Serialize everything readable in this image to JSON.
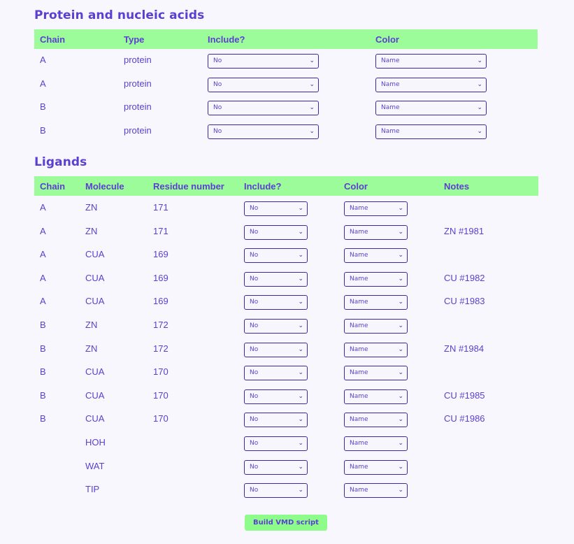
{
  "protein_section": {
    "title": "Protein and nucleic acids",
    "headers": {
      "chain": "Chain",
      "type": "Type",
      "include": "Include?",
      "color": "Color"
    },
    "rows": [
      {
        "chain": "A",
        "type": "protein",
        "include": "No",
        "color": "Name"
      },
      {
        "chain": "A",
        "type": "protein",
        "include": "No",
        "color": "Name"
      },
      {
        "chain": "B",
        "type": "protein",
        "include": "No",
        "color": "Name"
      },
      {
        "chain": "B",
        "type": "protein",
        "include": "No",
        "color": "Name"
      }
    ]
  },
  "ligand_section": {
    "title": "Ligands",
    "headers": {
      "chain": "Chain",
      "molecule": "Molecule",
      "residue": "Residue number",
      "include": "Include?",
      "color": "Color",
      "notes": "Notes"
    },
    "rows": [
      {
        "chain": "A",
        "molecule": "ZN",
        "residue": "171",
        "include": "No",
        "color": "Name",
        "notes": ""
      },
      {
        "chain": "A",
        "molecule": "ZN",
        "residue": "171",
        "include": "No",
        "color": "Name",
        "notes": "ZN #1981"
      },
      {
        "chain": "A",
        "molecule": "CUA",
        "residue": "169",
        "include": "No",
        "color": "Name",
        "notes": ""
      },
      {
        "chain": "A",
        "molecule": "CUA",
        "residue": "169",
        "include": "No",
        "color": "Name",
        "notes": "CU #1982"
      },
      {
        "chain": "A",
        "molecule": "CUA",
        "residue": "169",
        "include": "No",
        "color": "Name",
        "notes": "CU #1983"
      },
      {
        "chain": "B",
        "molecule": "ZN",
        "residue": "172",
        "include": "No",
        "color": "Name",
        "notes": ""
      },
      {
        "chain": "B",
        "molecule": "ZN",
        "residue": "172",
        "include": "No",
        "color": "Name",
        "notes": "ZN #1984"
      },
      {
        "chain": "B",
        "molecule": "CUA",
        "residue": "170",
        "include": "No",
        "color": "Name",
        "notes": ""
      },
      {
        "chain": "B",
        "molecule": "CUA",
        "residue": "170",
        "include": "No",
        "color": "Name",
        "notes": "CU #1985"
      },
      {
        "chain": "B",
        "molecule": "CUA",
        "residue": "170",
        "include": "No",
        "color": "Name",
        "notes": "CU #1986"
      },
      {
        "chain": "",
        "molecule": "HOH",
        "residue": "",
        "include": "No",
        "color": "Name",
        "notes": ""
      },
      {
        "chain": "",
        "molecule": "WAT",
        "residue": "",
        "include": "No",
        "color": "Name",
        "notes": ""
      },
      {
        "chain": "",
        "molecule": "TIP",
        "residue": "",
        "include": "No",
        "color": "Name",
        "notes": ""
      }
    ]
  },
  "build_button": {
    "label": "Build VMD script"
  },
  "icons": {
    "dropdown": "chevron-down-icon"
  },
  "colors": {
    "accent_text": "#5b3fd1",
    "header_bg": "#9dfc9a",
    "button_bg": "#8dfc8a",
    "page_bg": "#f8f7fd"
  }
}
